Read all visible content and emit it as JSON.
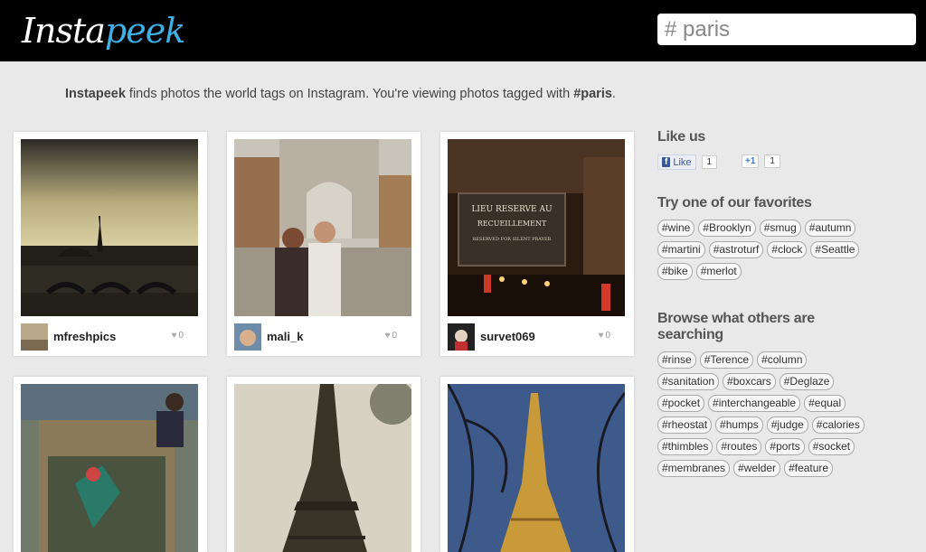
{
  "header": {
    "logo_part1": "Insta",
    "logo_part2": "peek",
    "search_value": "# paris"
  },
  "intro": {
    "brand": "Instapeek",
    "text": " finds photos the world tags on Instagram. You're viewing photos tagged with ",
    "tag": "#paris",
    "end": "."
  },
  "cards": [
    {
      "username": "mfreshpics",
      "likes": "0"
    },
    {
      "username": "mali_k",
      "likes": "0"
    },
    {
      "username": "survet069",
      "likes": "0"
    }
  ],
  "photo3_sign": {
    "line1": "LIEU RESERVE AU",
    "line2": "RECUEILLEMENT",
    "line3": "RESERVED FOR SILENT PRAYER"
  },
  "sidebar": {
    "like_title": "Like us",
    "fb_label": "Like",
    "fb_count": "1",
    "gplus_label": "+1",
    "gplus_count": "1",
    "favorites_title": "Try one of our favorites",
    "favorites": [
      "#wine",
      "#Brooklyn",
      "#smug",
      "#autumn",
      "#martini",
      "#astroturf",
      "#clock",
      "#Seattle",
      "#bike",
      "#merlot"
    ],
    "browse_title": "Browse what others are searching",
    "browse": [
      "#rinse",
      "#Terence",
      "#column",
      "#sanitation",
      "#boxcars",
      "#Deglaze",
      "#pocket",
      "#interchangeable",
      "#equal",
      "#rheostat",
      "#humps",
      "#judge",
      "#calories",
      "#thimbles",
      "#routes",
      "#ports",
      "#socket",
      "#membranes",
      "#welder",
      "#feature"
    ]
  },
  "colors": {
    "accent": "#3fb0e6",
    "header_bg": "#000000",
    "page_bg": "#e9e9e9"
  }
}
